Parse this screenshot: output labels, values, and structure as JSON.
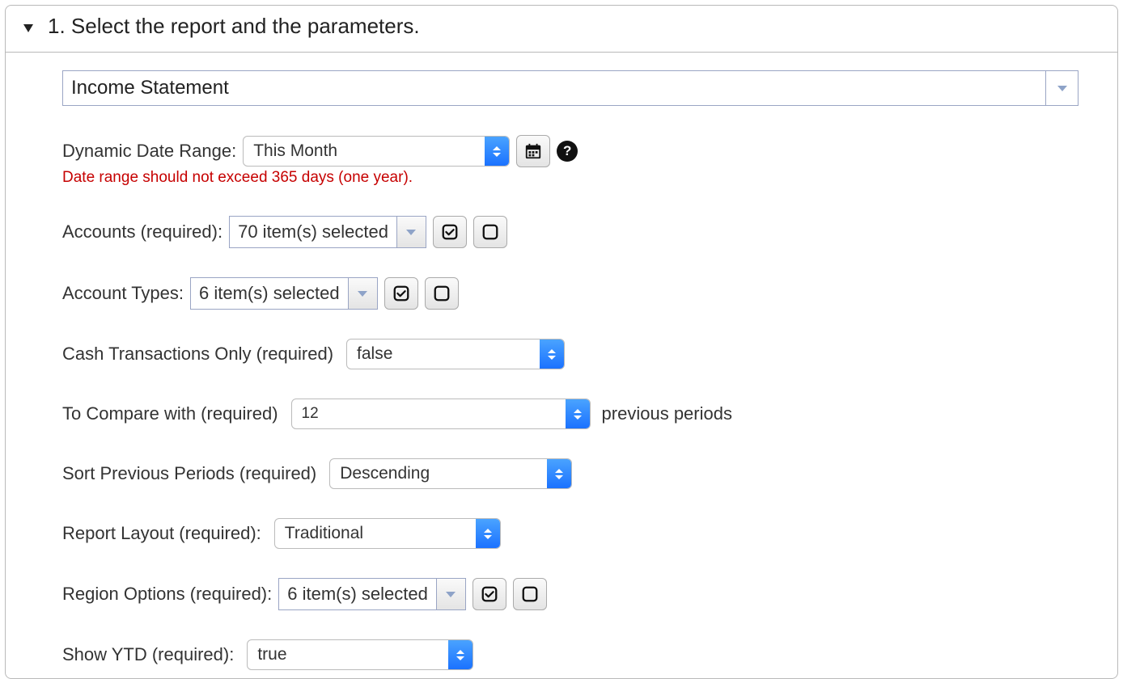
{
  "panel": {
    "title": "1. Select the report and the parameters."
  },
  "report_select": {
    "value": "Income Statement"
  },
  "date_range": {
    "label": "Dynamic Date Range:",
    "value": "This Month",
    "warning": "Date range should not exceed 365 days (one year)."
  },
  "accounts": {
    "label": "Accounts (required):",
    "value": "70 item(s) selected"
  },
  "account_types": {
    "label": "Account Types:",
    "value": "6 item(s) selected"
  },
  "cash_only": {
    "label": "Cash Transactions Only (required)",
    "value": "false"
  },
  "compare": {
    "label": "To Compare with (required)",
    "value": "12",
    "suffix": "previous periods"
  },
  "sort": {
    "label": "Sort Previous Periods (required)",
    "value": "Descending"
  },
  "layout": {
    "label": "Report Layout (required):",
    "value": "Traditional"
  },
  "region": {
    "label": "Region Options (required):",
    "value": "6 item(s) selected"
  },
  "ytd": {
    "label": "Show YTD (required):",
    "value": "true"
  }
}
